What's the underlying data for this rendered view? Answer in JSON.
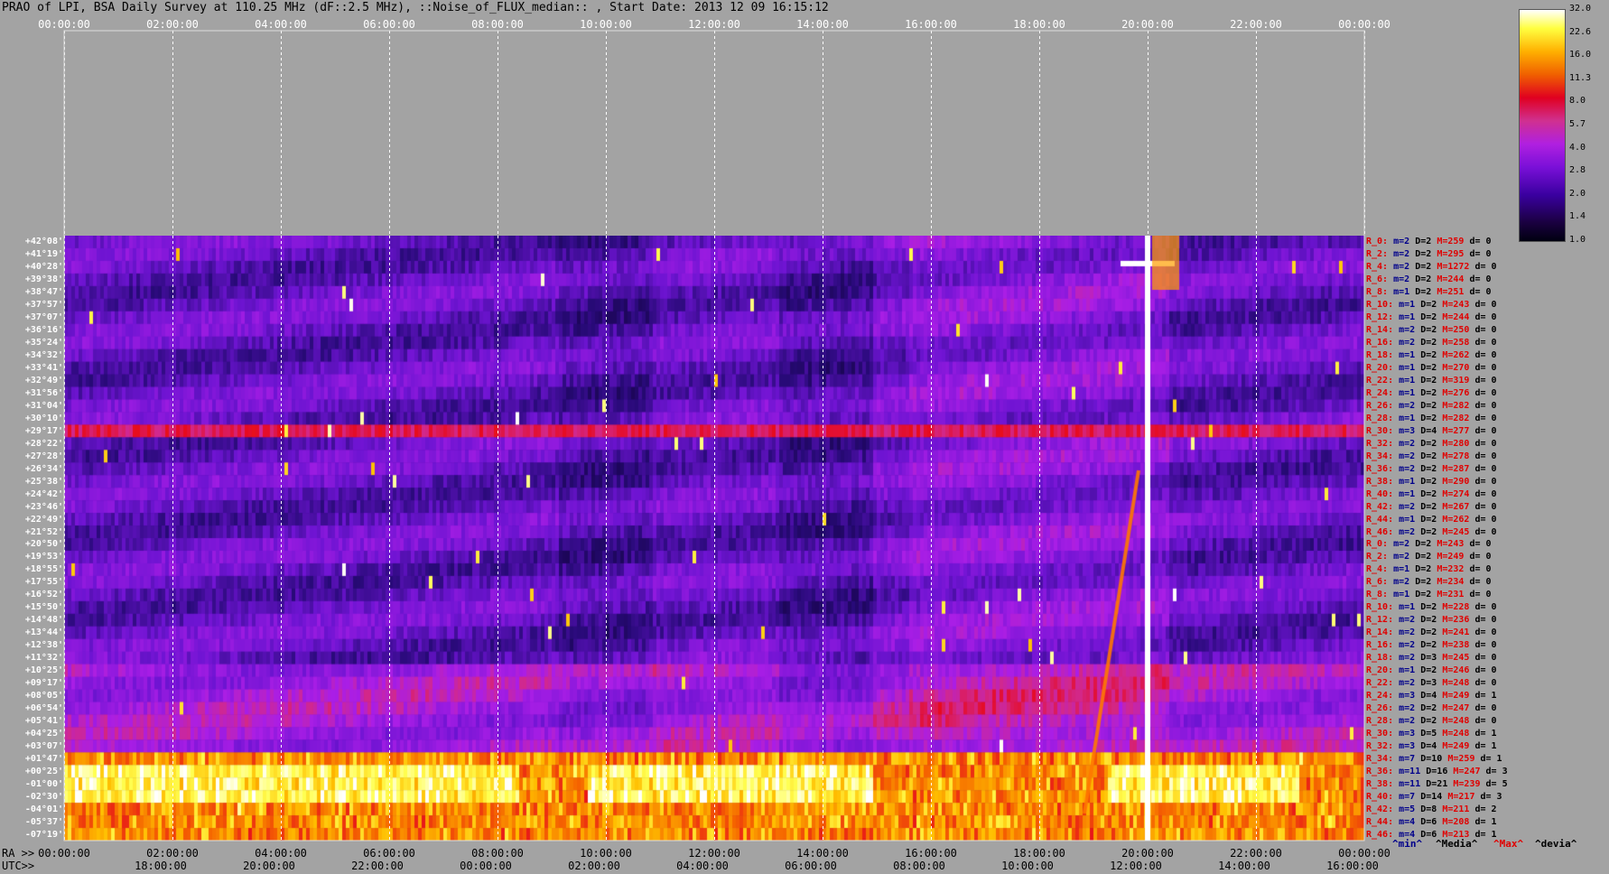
{
  "title": "PRAO of LPI, BSA Daily Survey at 110.25 MHz (dF::2.5 MHz), ::Noise_of_FLUX_median:: , Start Date: 2013 12 09 16:15:12",
  "top_ticks": [
    "00:00:00",
    "02:00:00",
    "04:00:00",
    "06:00:00",
    "08:00:00",
    "10:00:00",
    "12:00:00",
    "14:00:00",
    "16:00:00",
    "18:00:00",
    "20:00:00",
    "22:00:00",
    "00:00:00"
  ],
  "ra_label": "RA >>",
  "ra_ticks": [
    "00:00:00",
    "02:00:00",
    "04:00:00",
    "06:00:00",
    "08:00:00",
    "10:00:00",
    "12:00:00",
    "14:00:00",
    "16:00:00",
    "18:00:00",
    "20:00:00",
    "22:00:00",
    "00:00:00"
  ],
  "utc_label": "UTC>>",
  "utc_ticks": [
    "18:00:00",
    "20:00:00",
    "22:00:00",
    "00:00:00",
    "02:00:00",
    "04:00:00",
    "06:00:00",
    "08:00:00",
    "10:00:00",
    "12:00:00",
    "14:00:00",
    "16:00:00"
  ],
  "colorbar": {
    "labels": [
      "32.0",
      "22.6",
      "16.0",
      "11.3",
      "8.0",
      "5.7",
      "4.0",
      "2.8",
      "2.0",
      "1.4",
      "1.0"
    ]
  },
  "legend": {
    "min": "^min^",
    "media": "^Media^",
    "max": "^Max^",
    "devia": "^devia^"
  },
  "declinations": [
    "+42°08'",
    "+41°19'",
    "+40°28'",
    "+39°38'",
    "+38°47'",
    "+37°57'",
    "+37°07'",
    "+36°16'",
    "+35°24'",
    "+34°32'",
    "+33°41'",
    "+32°49'",
    "+31°56'",
    "+31°04'",
    "+30°10'",
    "+29°17'",
    "+28°22'",
    "+27°28'",
    "+26°34'",
    "+25°38'",
    "+24°42'",
    "+23°46'",
    "+22°49'",
    "+21°52'",
    "+20°50'",
    "+19°53'",
    "+18°55'",
    "+17°55'",
    "+16°52'",
    "+15°50'",
    "+14°48'",
    "+13°44'",
    "+12°38'",
    "+11°32'",
    "+10°25'",
    "+09°17'",
    "+08°05'",
    "+06°54'",
    "+05°41'",
    "+04°25'",
    "+03°07'",
    "+01°47'",
    "+00°25'",
    "-01°00'",
    "-02°30'",
    "-04°01'",
    "-05°37'",
    "-07°19'"
  ],
  "row_stats": [
    {
      "r": "R_0:",
      "m": "m=2",
      "D": "D=2",
      "M": "M=259",
      "d": "d= 0"
    },
    {
      "r": "R_2:",
      "m": "m=2",
      "D": "D=2",
      "M": "M=295",
      "d": "d= 0"
    },
    {
      "r": "R_4:",
      "m": "m=2",
      "D": "D=2",
      "M": "M=1272",
      "d": "d= 0"
    },
    {
      "r": "R_6:",
      "m": "m=2",
      "D": "D=2",
      "M": "M=244",
      "d": "d= 0"
    },
    {
      "r": "R_8:",
      "m": "m=1",
      "D": "D=2",
      "M": "M=251",
      "d": "d= 0"
    },
    {
      "r": "R_10:",
      "m": "m=1",
      "D": "D=2",
      "M": "M=243",
      "d": "d= 0"
    },
    {
      "r": "R_12:",
      "m": "m=1",
      "D": "D=2",
      "M": "M=244",
      "d": "d= 0"
    },
    {
      "r": "R_14:",
      "m": "m=2",
      "D": "D=2",
      "M": "M=250",
      "d": "d= 0"
    },
    {
      "r": "R_16:",
      "m": "m=2",
      "D": "D=2",
      "M": "M=258",
      "d": "d= 0"
    },
    {
      "r": "R_18:",
      "m": "m=1",
      "D": "D=2",
      "M": "M=262",
      "d": "d= 0"
    },
    {
      "r": "R_20:",
      "m": "m=1",
      "D": "D=2",
      "M": "M=270",
      "d": "d= 0"
    },
    {
      "r": "R_22:",
      "m": "m=1",
      "D": "D=2",
      "M": "M=319",
      "d": "d= 0"
    },
    {
      "r": "R_24:",
      "m": "m=1",
      "D": "D=2",
      "M": "M=276",
      "d": "d= 0"
    },
    {
      "r": "R_26:",
      "m": "m=2",
      "D": "D=2",
      "M": "M=282",
      "d": "d= 0"
    },
    {
      "r": "R_28:",
      "m": "m=1",
      "D": "D=2",
      "M": "M=282",
      "d": "d= 0"
    },
    {
      "r": "R_30:",
      "m": "m=3",
      "D": "D=4",
      "M": "M=277",
      "d": "d= 0"
    },
    {
      "r": "R_32:",
      "m": "m=2",
      "D": "D=2",
      "M": "M=280",
      "d": "d= 0"
    },
    {
      "r": "R_34:",
      "m": "m=2",
      "D": "D=2",
      "M": "M=278",
      "d": "d= 0"
    },
    {
      "r": "R_36:",
      "m": "m=2",
      "D": "D=2",
      "M": "M=287",
      "d": "d= 0"
    },
    {
      "r": "R_38:",
      "m": "m=1",
      "D": "D=2",
      "M": "M=290",
      "d": "d= 0"
    },
    {
      "r": "R_40:",
      "m": "m=1",
      "D": "D=2",
      "M": "M=274",
      "d": "d= 0"
    },
    {
      "r": "R_42:",
      "m": "m=2",
      "D": "D=2",
      "M": "M=267",
      "d": "d= 0"
    },
    {
      "r": "R_44:",
      "m": "m=1",
      "D": "D=2",
      "M": "M=262",
      "d": "d= 0"
    },
    {
      "r": "R_46:",
      "m": "m=2",
      "D": "D=2",
      "M": "M=245",
      "d": "d= 0"
    },
    {
      "r": "R_0:",
      "m": "m=2",
      "D": "D=2",
      "M": "M=243",
      "d": "d= 0"
    },
    {
      "r": "R_2:",
      "m": "m=2",
      "D": "D=2",
      "M": "M=249",
      "d": "d= 0"
    },
    {
      "r": "R_4:",
      "m": "m=1",
      "D": "D=2",
      "M": "M=232",
      "d": "d= 0"
    },
    {
      "r": "R_6:",
      "m": "m=2",
      "D": "D=2",
      "M": "M=234",
      "d": "d= 0"
    },
    {
      "r": "R_8:",
      "m": "m=1",
      "D": "D=2",
      "M": "M=231",
      "d": "d= 0"
    },
    {
      "r": "R_10:",
      "m": "m=1",
      "D": "D=2",
      "M": "M=228",
      "d": "d= 0"
    },
    {
      "r": "R_12:",
      "m": "m=2",
      "D": "D=2",
      "M": "M=236",
      "d": "d= 0"
    },
    {
      "r": "R_14:",
      "m": "m=2",
      "D": "D=2",
      "M": "M=241",
      "d": "d= 0"
    },
    {
      "r": "R_16:",
      "m": "m=2",
      "D": "D=2",
      "M": "M=238",
      "d": "d= 0"
    },
    {
      "r": "R_18:",
      "m": "m=2",
      "D": "D=3",
      "M": "M=245",
      "d": "d= 0"
    },
    {
      "r": "R_20:",
      "m": "m=1",
      "D": "D=2",
      "M": "M=246",
      "d": "d= 0"
    },
    {
      "r": "R_22:",
      "m": "m=2",
      "D": "D=3",
      "M": "M=248",
      "d": "d= 0"
    },
    {
      "r": "R_24:",
      "m": "m=3",
      "D": "D=4",
      "M": "M=249",
      "d": "d= 1"
    },
    {
      "r": "R_26:",
      "m": "m=2",
      "D": "D=2",
      "M": "M=247",
      "d": "d= 0"
    },
    {
      "r": "R_28:",
      "m": "m=2",
      "D": "D=2",
      "M": "M=248",
      "d": "d= 0"
    },
    {
      "r": "R_30:",
      "m": "m=3",
      "D": "D=5",
      "M": "M=248",
      "d": "d= 1"
    },
    {
      "r": "R_32:",
      "m": "m=3",
      "D": "D=4",
      "M": "M=249",
      "d": "d= 1"
    },
    {
      "r": "R_34:",
      "m": "m=7",
      "D": "D=10",
      "M": "M=259",
      "d": "d= 1"
    },
    {
      "r": "R_36:",
      "m": "m=11",
      "D": "D=16",
      "M": "M=247",
      "d": "d= 3"
    },
    {
      "r": "R_38:",
      "m": "m=11",
      "D": "D=21",
      "M": "M=239",
      "d": "d= 5"
    },
    {
      "r": "R_40:",
      "m": "m=7",
      "D": "D=14",
      "M": "M=217",
      "d": "d= 3"
    },
    {
      "r": "R_42:",
      "m": "m=5",
      "D": "D=8",
      "M": "M=211",
      "d": "d= 2"
    },
    {
      "r": "R_44:",
      "m": "m=4",
      "D": "D=6",
      "M": "M=208",
      "d": "d= 1"
    },
    {
      "r": "R_46:",
      "m": "m=4",
      "D": "D=6",
      "M": "M=213",
      "d": "d= 1"
    }
  ],
  "chart_data": {
    "type": "heatmap",
    "title": "PRAO of LPI, BSA Daily Survey at 110.25 MHz (dF::2.5 MHz), ::Noise_of_FLUX_median:: , Start Date: 2013 12 09 16:15:12",
    "x_axis": "RA 00:00:00 to 00:00:00 (24 h)",
    "y_axis": "Declination +42°08' to -07°19' (48 beams)",
    "color_scale": [
      1.0,
      1.4,
      2.0,
      2.8,
      4.0,
      5.7,
      8.0,
      11.3,
      16.0,
      22.6,
      32.0
    ],
    "features": [
      {
        "ra_h": 20.0,
        "dec_row": 2,
        "note": "bright source"
      },
      {
        "ra_h": 19.2,
        "dec_row": 40,
        "note": "diagonal streak"
      }
    ]
  }
}
